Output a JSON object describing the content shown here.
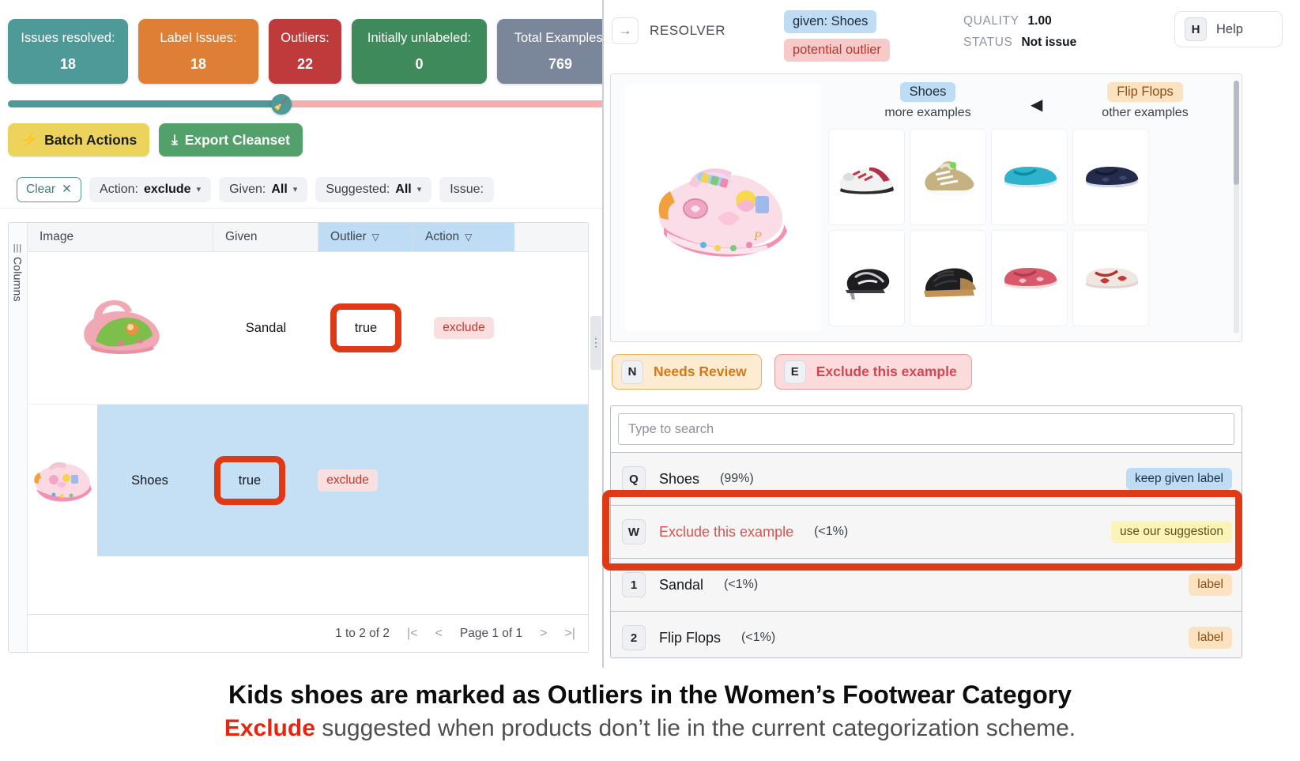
{
  "stats": [
    {
      "label": "Issues resolved:",
      "value": "18",
      "color": "#4d9a99"
    },
    {
      "label": "Label Issues:",
      "value": "18",
      "color": "#df7e35"
    },
    {
      "label": "Outliers:",
      "value": "22",
      "color": "#bf3b3b"
    },
    {
      "label": "Initially unlabeled:",
      "value": "0",
      "color": "#3f8a5a"
    },
    {
      "label": "Total Examples:",
      "value": "769",
      "color": "#7a8699"
    }
  ],
  "progress": {
    "percent": 45,
    "fill_color": "#4d9a99",
    "track_color": "#f4aeae",
    "knob_icon": "broom-icon"
  },
  "actions": {
    "batch_label": "Batch Actions",
    "batch_icon": "bolt-icon",
    "export_label": "Export Cleanset",
    "export_icon": "download-icon"
  },
  "filters": {
    "clear_label": "Clear",
    "clear_icon": "close-icon",
    "items": [
      {
        "key": "Action:",
        "value": "exclude"
      },
      {
        "key": "Given:",
        "value": "All"
      },
      {
        "key": "Suggested:",
        "value": "All"
      },
      {
        "key": "Issue:",
        "value": ""
      }
    ]
  },
  "table": {
    "columns_rail_label": "Columns",
    "headers": [
      {
        "label": "Image",
        "filter": false
      },
      {
        "label": "Given",
        "filter": false
      },
      {
        "label": "Outlier",
        "filter": true
      },
      {
        "label": "Action",
        "filter": true
      }
    ],
    "rows": [
      {
        "given": "Sandal",
        "outlier": "true",
        "action": "exclude",
        "image": "pink-clog-shoe-image",
        "selected": false
      },
      {
        "given": "Shoes",
        "outlier": "true",
        "action": "exclude",
        "image": "pink-princess-shoe-image",
        "selected": true
      }
    ],
    "footer": {
      "range": "1 to 2 of 2",
      "page": "Page 1 of 1",
      "first_icon": "first-page-icon",
      "prev_icon": "prev-page-icon",
      "next_icon": "next-page-icon",
      "last_icon": "last-page-icon"
    }
  },
  "resolver": {
    "title": "RESOLVER",
    "arrow_icon": "arrow-right-icon",
    "tags": [
      {
        "text": "given: Shoes",
        "style": "given"
      },
      {
        "text": "potential outlier",
        "style": "outlier"
      }
    ],
    "meta": [
      {
        "key": "QUALITY",
        "value": "1.00"
      },
      {
        "key": "STATUS",
        "value": "Not issue"
      }
    ],
    "help": {
      "key": "H",
      "label": "Help"
    }
  },
  "examples": {
    "main_image": "pink-princess-shoe-large-image",
    "groups": [
      {
        "tag": "Shoes",
        "sub": "more examples",
        "style": "shoes"
      },
      {
        "tag": "Flip Flops",
        "sub": "other examples",
        "style": "flip"
      }
    ],
    "prev_icon": "triangle-left-icon",
    "next_icon": "triangle-right-icon",
    "thumbnails": [
      [
        "white-red-running-shoe",
        "black-silver-heel-sandal"
      ],
      [
        "gold-white-high-top-sneaker",
        "black-wedge-strappy-sandal"
      ],
      [
        "teal-flip-flop",
        "red-printed-flip-flop"
      ],
      [
        "navy-flip-flop",
        "red-white-printed-flip-flop"
      ]
    ]
  },
  "review_buttons": [
    {
      "key": "N",
      "label": "Needs Review",
      "style": "review"
    },
    {
      "key": "E",
      "label": "Exclude this example",
      "style": "exclude"
    }
  ],
  "suggestions": {
    "search_placeholder": "Type to search",
    "search_value": "",
    "items": [
      {
        "key": "Q",
        "label": "Shoes",
        "pct": "(99%)",
        "badge": "keep given label",
        "badge_style": "keep",
        "danger": false
      },
      {
        "key": "W",
        "label": "Exclude this example",
        "pct": "(<1%)",
        "badge": "use our suggestion",
        "badge_style": "use",
        "danger": true
      },
      {
        "key": "1",
        "label": "Sandal",
        "pct": "(<1%)",
        "badge": "label",
        "badge_style": "label",
        "danger": false
      },
      {
        "key": "2",
        "label": "Flip Flops",
        "pct": "(<1%)",
        "badge": "label",
        "badge_style": "label",
        "danger": false
      }
    ]
  },
  "caption": {
    "line1": "Kids shoes are marked as Outliers in the Women’s Footwear Category",
    "line2_red": "Exclude",
    "line2_rest": " suggested when products don’t lie in the current categorization scheme."
  },
  "colors": {
    "highlight_red": "#de3a16",
    "selected_row_blue": "#c5dff5",
    "header_blue": "#bedcf3"
  }
}
